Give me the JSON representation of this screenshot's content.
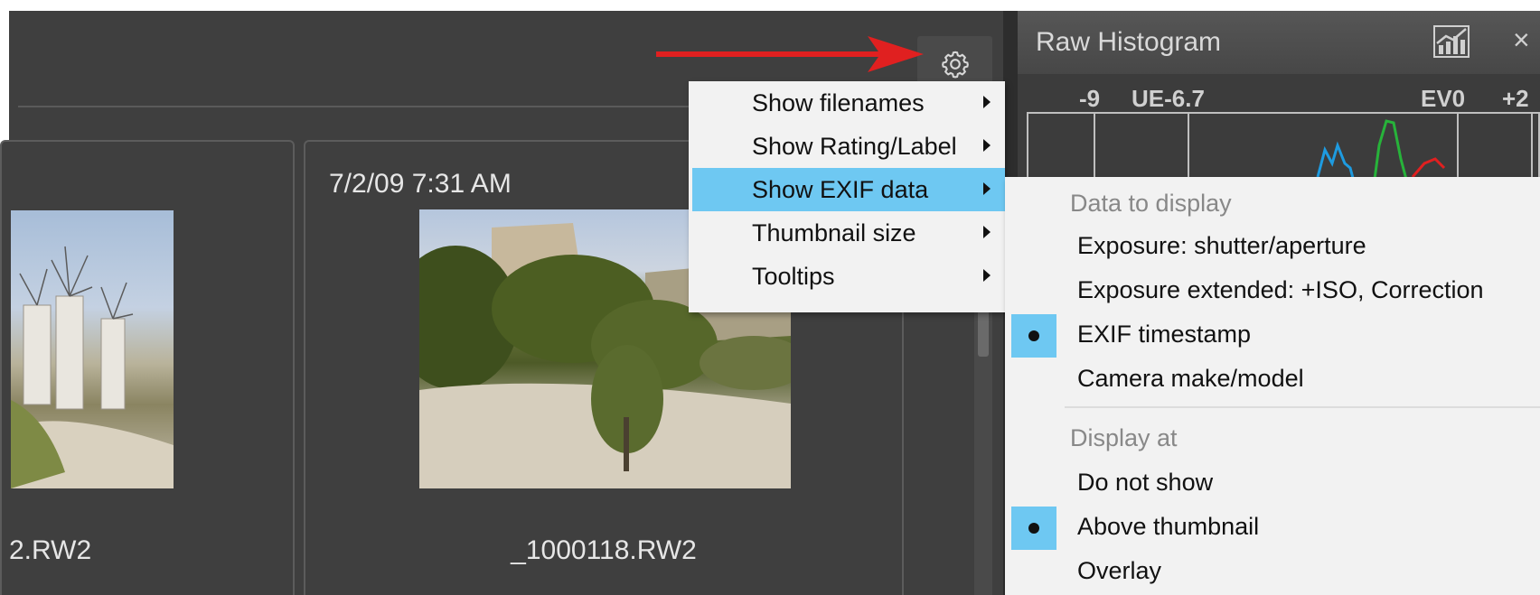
{
  "browser": {
    "cards": [
      {
        "date": "",
        "filename": "2.RW2"
      },
      {
        "date": "7/2/09 7:31 AM",
        "filename": "_1000118.RW2"
      }
    ]
  },
  "context_menu": {
    "items": [
      {
        "label": "Show filenames",
        "active": false
      },
      {
        "label": "Show Rating/Label",
        "active": false
      },
      {
        "label": "Show EXIF data",
        "active": true
      },
      {
        "label": "Thumbnail size",
        "active": false
      },
      {
        "label": "Tooltips",
        "active": false
      }
    ]
  },
  "exif_submenu": {
    "heading_data": "Data to display",
    "data_items": [
      {
        "label": "Exposure: shutter/aperture",
        "selected": false
      },
      {
        "label": "Exposure extended: +ISO, Correction",
        "selected": false
      },
      {
        "label": "EXIF timestamp",
        "selected": true
      },
      {
        "label": "Camera make/model",
        "selected": false
      }
    ],
    "heading_display": "Display at",
    "display_items": [
      {
        "label": "Do not show",
        "selected": false
      },
      {
        "label": "Above thumbnail",
        "selected": true
      },
      {
        "label": "Overlay",
        "selected": false
      }
    ]
  },
  "histogram": {
    "title": "Raw Histogram",
    "close": "×",
    "scale": [
      "-9",
      "UE-6.7",
      "EV0",
      "+2"
    ]
  },
  "colors": {
    "accent": "#6ec8f2",
    "panel_bg": "#3f3f3f",
    "annotation_arrow": "#e02020"
  },
  "icons": {
    "settings": "gear-icon",
    "histogram_mode": "chart-icon",
    "close": "close-icon"
  }
}
